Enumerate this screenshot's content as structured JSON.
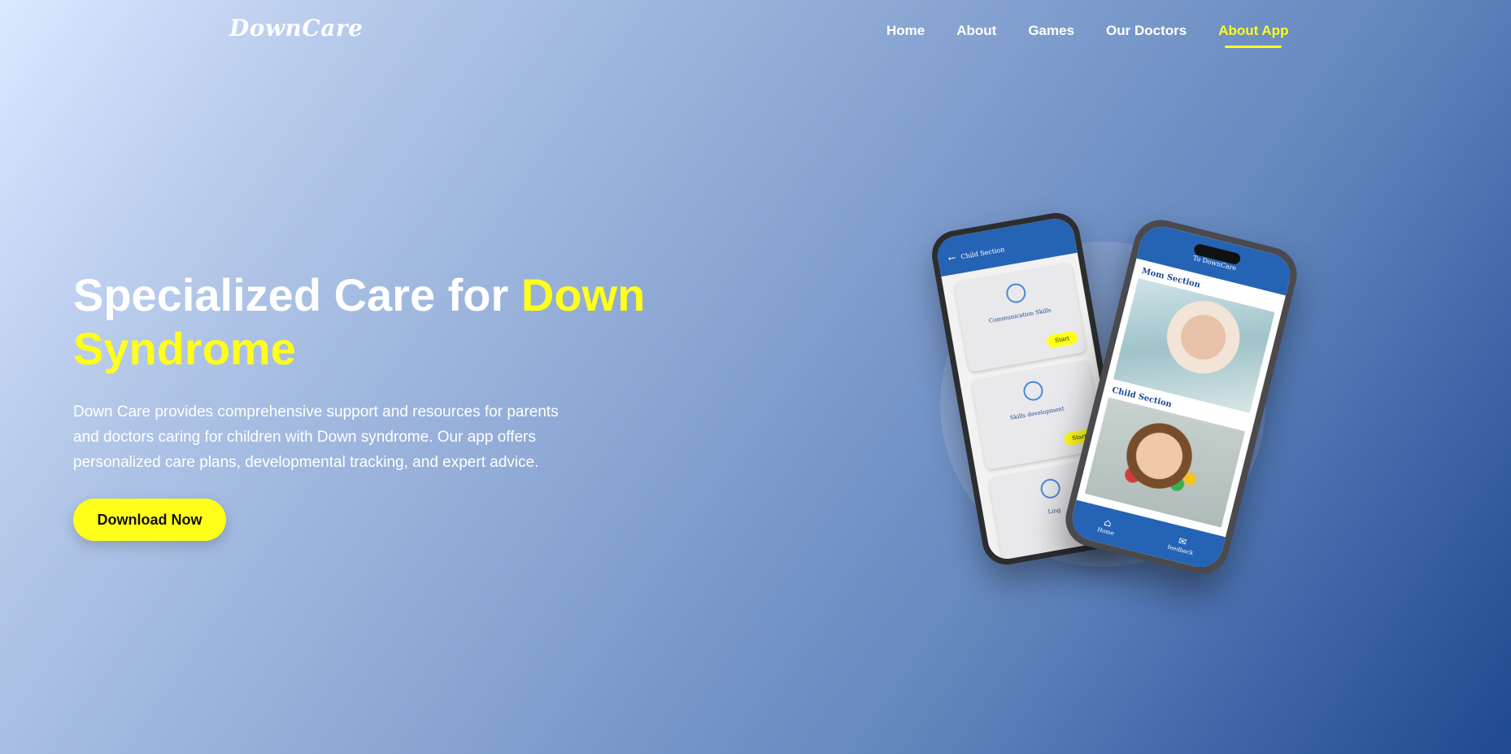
{
  "brand": {
    "logo": "DownCare"
  },
  "nav": {
    "items": [
      {
        "label": "Home",
        "active": false
      },
      {
        "label": "About",
        "active": false
      },
      {
        "label": "Games",
        "active": false
      },
      {
        "label": "Our Doctors",
        "active": false
      },
      {
        "label": "About App",
        "active": true
      }
    ]
  },
  "hero": {
    "title_part1": "Specialized Care for ",
    "title_highlight": "Down Syndrome",
    "description": "Down Care provides comprehensive support and resources for parents and doctors caring for children with Down syndrome. Our app offers personalized care plans, developmental tracking, and expert advice.",
    "cta_label": "Download Now"
  },
  "mockup": {
    "back_screen": {
      "header": "Child Section",
      "cards": [
        {
          "label": "Communication Skills",
          "button": "Start"
        },
        {
          "label": "Skills development",
          "button": "Start"
        },
        {
          "label": "Ling",
          "button": ""
        }
      ]
    },
    "front_screen": {
      "header": "To DownCare",
      "sections": [
        "Mom Section",
        "Child Section"
      ],
      "bottom_nav": [
        "Home",
        "feedback"
      ]
    }
  },
  "colors": {
    "accent": "#ffff1a",
    "app_blue": "#2563b5",
    "text": "#ffffff"
  }
}
